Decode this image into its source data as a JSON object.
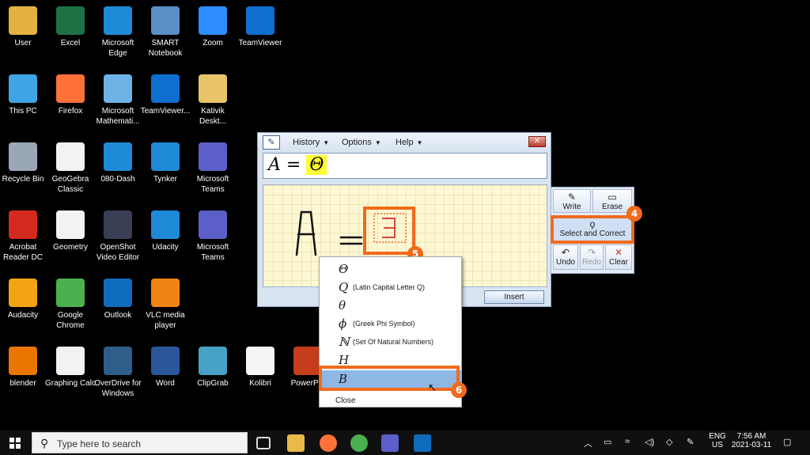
{
  "desktop_icons": [
    {
      "label": "User",
      "icon": "user-folder-icon",
      "color": "#e3b341"
    },
    {
      "label": "Excel",
      "icon": "excel-icon",
      "color": "#1e7145"
    },
    {
      "label": "Microsoft Edge",
      "icon": "edge-icon",
      "color": "#1f8ad8"
    },
    {
      "label": "SMART Notebook",
      "icon": "smart-notebook-icon",
      "color": "#5b8fc7"
    },
    {
      "label": "Zoom",
      "icon": "zoom-icon",
      "color": "#2d8cff"
    },
    {
      "label": "TeamViewer",
      "icon": "teamviewer-icon",
      "color": "#0e6fcf"
    },
    {
      "label": "This PC",
      "icon": "this-pc-icon",
      "color": "#3ea4e4"
    },
    {
      "label": "Firefox",
      "icon": "firefox-icon",
      "color": "#ff7139"
    },
    {
      "label": "Microsoft Mathemati...",
      "icon": "math-solver-icon",
      "color": "#6fb2e6"
    },
    {
      "label": "TeamViewer...",
      "icon": "teamviewer-icon",
      "color": "#0e6fcf"
    },
    {
      "label": "Kativik Deskt...",
      "icon": "folder-icon",
      "color": "#e9c46a"
    },
    {
      "label": "Recycle Bin",
      "icon": "recycle-bin-icon",
      "color": "#9aa7b4"
    },
    {
      "label": "GeoGebra Classic",
      "icon": "geogebra-icon",
      "color": "#f2f2f2"
    },
    {
      "label": "080-Dash",
      "icon": "edge-icon",
      "color": "#1f8ad8"
    },
    {
      "label": "Tynker",
      "icon": "edge-icon",
      "color": "#1f8ad8"
    },
    {
      "label": "Microsoft Teams",
      "icon": "teams-icon",
      "color": "#5b5fc7"
    },
    {
      "label": "Acrobat Reader DC",
      "icon": "acrobat-icon",
      "color": "#d4291f"
    },
    {
      "label": "Geometry",
      "icon": "geometry-icon",
      "color": "#f2f2f2"
    },
    {
      "label": "OpenShot Video Editor",
      "icon": "openshot-icon",
      "color": "#3a3f55"
    },
    {
      "label": "Udacity",
      "icon": "edge-icon",
      "color": "#1f8ad8"
    },
    {
      "label": "Microsoft Teams",
      "icon": "teams-icon",
      "color": "#5b5fc7"
    },
    {
      "label": "Audacity",
      "icon": "audacity-icon",
      "color": "#f3a412"
    },
    {
      "label": "Google Chrome",
      "icon": "chrome-icon",
      "color": "#4caf50"
    },
    {
      "label": "Outlook",
      "icon": "outlook-icon",
      "color": "#0f6cbd"
    },
    {
      "label": "VLC media player",
      "icon": "vlc-icon",
      "color": "#f08413"
    },
    {
      "label": "blender",
      "icon": "blender-icon",
      "color": "#ea7600"
    },
    {
      "label": "Graphing Calc",
      "icon": "graphing-calc-icon",
      "color": "#f2f2f2"
    },
    {
      "label": "OverDrive for Windows",
      "icon": "overdrive-icon",
      "color": "#2f5e8a"
    },
    {
      "label": "Word",
      "icon": "word-icon",
      "color": "#2b579a"
    },
    {
      "label": "ClipGrab",
      "icon": "clipgrab-icon",
      "color": "#46a3c7"
    },
    {
      "label": "Kolibri",
      "icon": "kolibri-icon",
      "color": "#f5f5f5"
    },
    {
      "label": "PowerPoi",
      "icon": "powerpoint-icon",
      "color": "#c43e1c"
    }
  ],
  "math_panel": {
    "menus": [
      "History",
      "Options",
      "Help"
    ],
    "close_label": "✕",
    "preview_prefix": "A = ",
    "preview_highlight": "Θ",
    "handwriting_left": "A",
    "handwriting_eq": "=",
    "handwriting_selected": "B",
    "insert_label": "Insert"
  },
  "tools": {
    "write": "Write",
    "erase": "Erase",
    "select_correct": "Select and Correct",
    "undo": "Undo",
    "redo": "Redo",
    "clear": "Clear"
  },
  "callouts": {
    "four": "4",
    "five": "5",
    "six": "6"
  },
  "context_menu": {
    "items": [
      {
        "sym": "Θ",
        "desc": ""
      },
      {
        "sym": "Q",
        "desc": "(Latin Capital Letter Q)"
      },
      {
        "sym": "θ",
        "desc": ""
      },
      {
        "sym": "ϕ",
        "desc": "(Greek Phi Symbol)"
      },
      {
        "sym": "ℕ",
        "desc": "(Set Of Natural Numbers)"
      },
      {
        "sym": "H",
        "desc": ""
      },
      {
        "sym": "B",
        "desc": ""
      }
    ],
    "close": "Close"
  },
  "taskbar": {
    "search_placeholder": "Type here to search",
    "lang": "ENG",
    "region": "US",
    "time": "7:56 AM",
    "date": "2021-03-11"
  }
}
